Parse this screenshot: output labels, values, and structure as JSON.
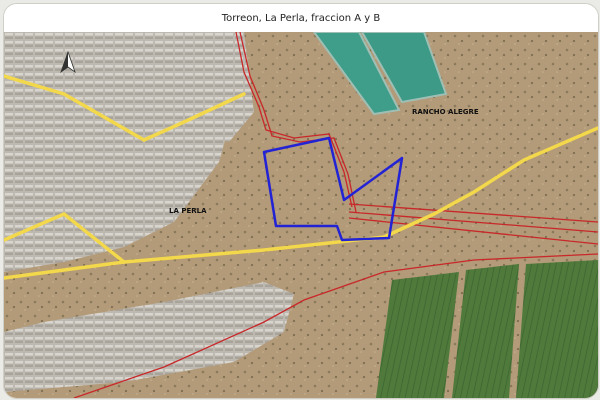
{
  "title": "Torreon, La Perla, fraccion A y B",
  "labels": {
    "la_perla": "LA PERLA",
    "rancho_alegre": "RANCHO ALEGRE"
  },
  "colors": {
    "main_road": "#f2d84a",
    "property_outline": "#2323d6",
    "boundary_lines": "#c8282a",
    "urban": "#b9b5ae",
    "desert": "#b39a78",
    "water": "#3f9e8a",
    "crop_fields": "#4f7a3c"
  },
  "icons": {
    "north_arrow": "north-arrow-icon"
  }
}
